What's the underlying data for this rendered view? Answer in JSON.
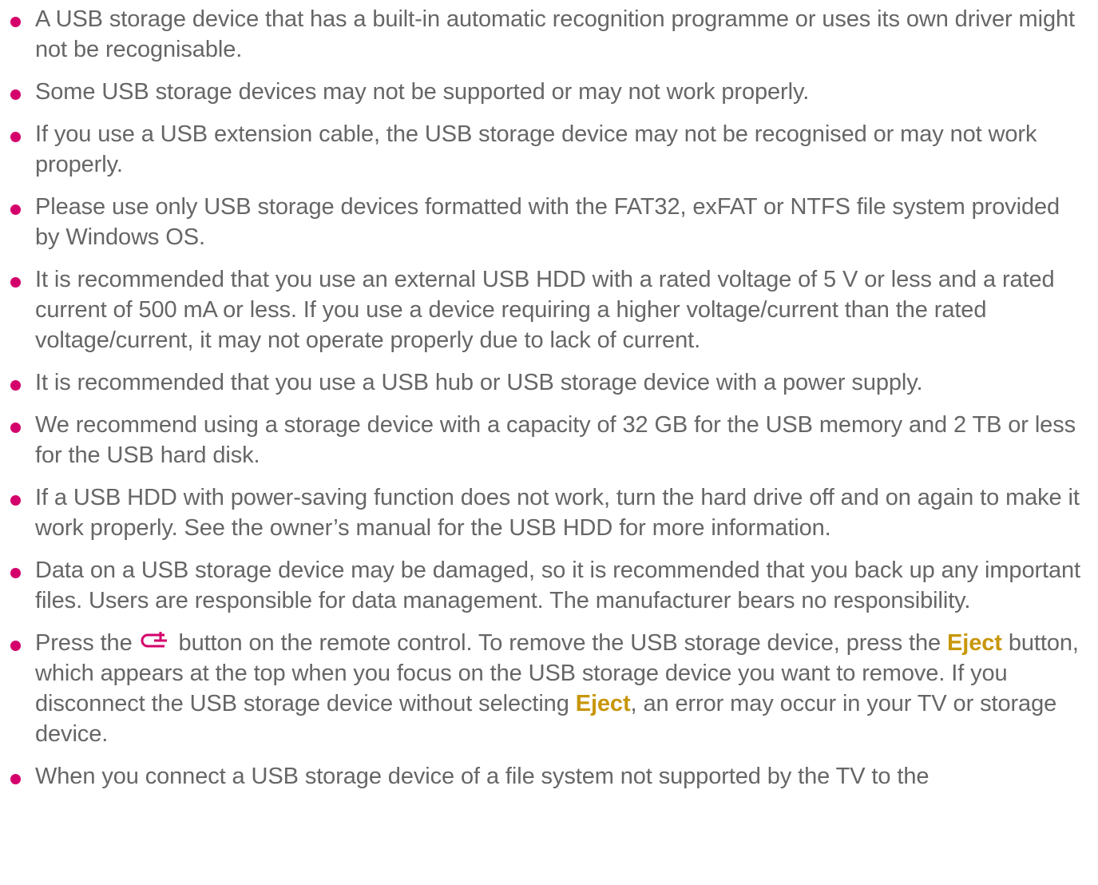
{
  "colors": {
    "bullet": "#d4006b",
    "text": "#666666",
    "keyword": "#c8960a",
    "icon": "#d4006b"
  },
  "notes": [
    "A USB storage device that has a built-in automatic recognition programme or uses its own driver might not be recognisable.",
    "Some USB storage devices may not be supported or may not work properly.",
    "If you use a USB extension cable, the USB storage device may not be recognised or may not work properly.",
    "Please use only USB storage devices formatted with the FAT32, exFAT or NTFS file system provided by Windows OS.",
    "It is recommended that you use an external USB HDD with a rated voltage of 5 V or less and a rated current of 500 mA or less. If you use a device requiring a higher voltage/current than the rated voltage/current, it may not operate properly due to lack of current.",
    "It is recommended that you use a USB hub or USB storage device with a power supply.",
    "We recommend using a storage device with a capacity of 32 GB for the USB memory and 2 TB or less for the USB hard disk.",
    "If a USB HDD with power-saving function does not work, turn the hard drive off and on again to make it work properly. See the owner’s manual for the USB HDD for more information.",
    "Data on a USB storage device may be damaged, so it is recommended that you back up any important files. Users are responsible for data management. The manufacturer bears no responsibility."
  ],
  "eject_note": {
    "part1": "Press the",
    "icon": "input-source-icon",
    "part2": "button on the remote control. To remove the USB storage device, press the",
    "keyword1": "Eject",
    "part3": "button, which appears at the top when you focus on the USB storage device you want to remove. If you disconnect the USB storage device without selecting",
    "keyword2": "Eject",
    "part4": ", an error may occur in your TV or storage device."
  },
  "last_note": "When you connect a USB storage device of a file system not supported by the TV to the"
}
